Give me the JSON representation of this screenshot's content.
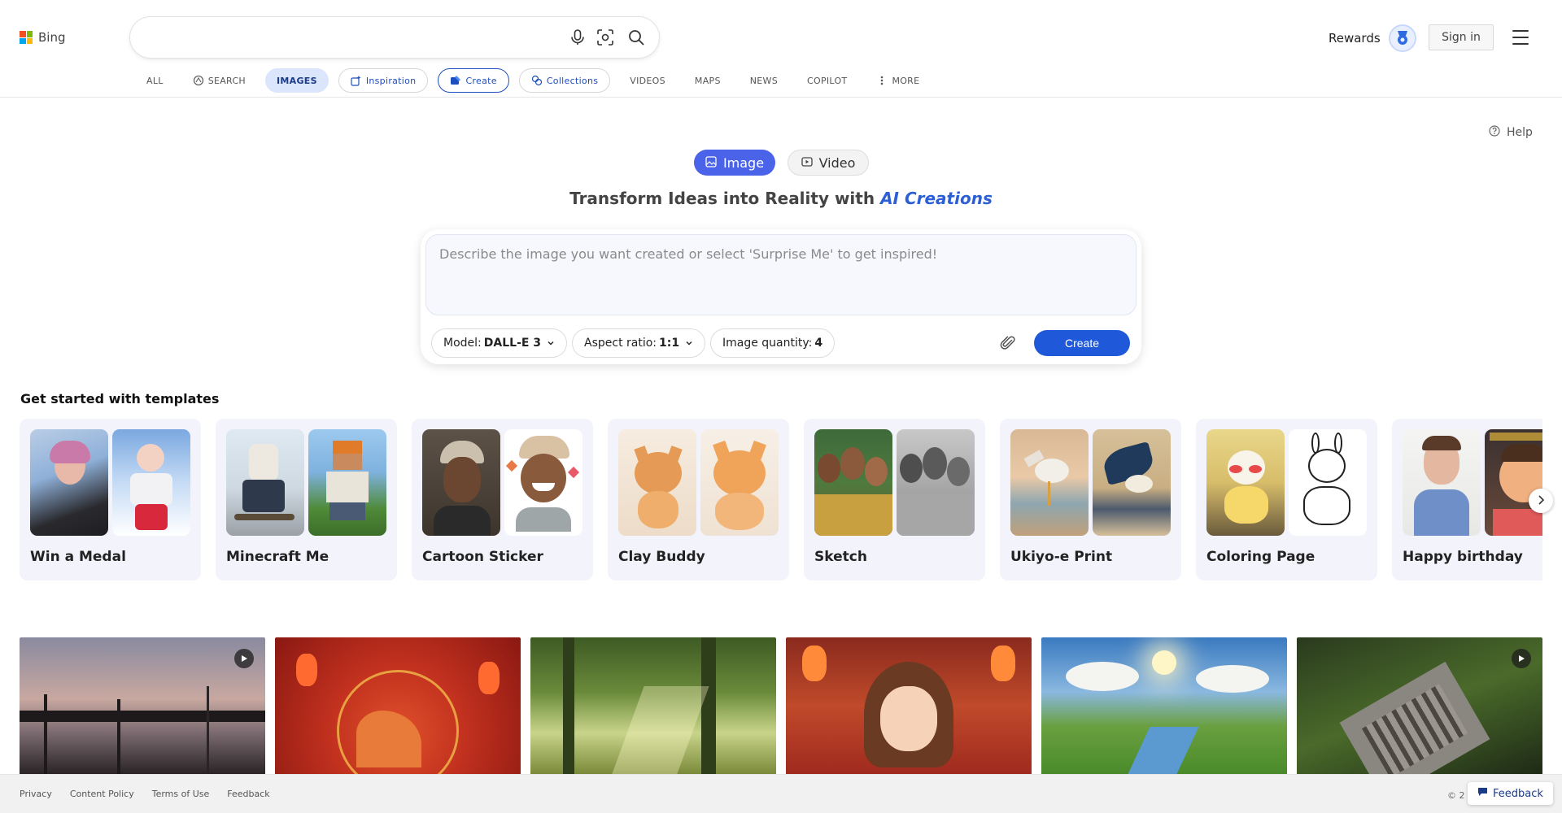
{
  "brand": {
    "name": "Bing"
  },
  "search": {
    "placeholder": "",
    "value": ""
  },
  "header": {
    "rewards_label": "Rewards",
    "signin_label": "Sign in"
  },
  "tabs": [
    {
      "label": "ALL"
    },
    {
      "label": "SEARCH"
    },
    {
      "label": "IMAGES"
    },
    {
      "label": "Inspiration"
    },
    {
      "label": "Create"
    },
    {
      "label": "Collections"
    },
    {
      "label": "VIDEOS"
    },
    {
      "label": "MAPS"
    },
    {
      "label": "NEWS"
    },
    {
      "label": "COPILOT"
    },
    {
      "label": "MORE"
    }
  ],
  "help_label": "Help",
  "mode": {
    "image_label": "Image",
    "video_label": "Video"
  },
  "headline": {
    "prefix": "Transform Ideas into Reality with ",
    "accent": "AI Creations"
  },
  "prompt": {
    "placeholder": "Describe the image you want created or select 'Surprise Me' to get inspired!",
    "model_label": "Model:",
    "model_value": "DALL-E 3",
    "aspect_label": "Aspect ratio:",
    "aspect_value": "1:1",
    "quantity_label": "Image quantity:",
    "quantity_value": "4",
    "create_label": "Create"
  },
  "templates": {
    "heading": "Get started with templates",
    "items": [
      {
        "label": "Win a Medal"
      },
      {
        "label": "Minecraft Me"
      },
      {
        "label": "Cartoon Sticker"
      },
      {
        "label": "Clay Buddy"
      },
      {
        "label": "Sketch"
      },
      {
        "label": "Ukiyo-e Print"
      },
      {
        "label": "Coloring Page"
      },
      {
        "label": "Happy birthday"
      }
    ]
  },
  "footer": {
    "links": [
      "Privacy",
      "Content Policy",
      "Terms of Use",
      "Feedback"
    ],
    "copyright": "© 2",
    "feedback_label": "Feedback"
  },
  "colors": {
    "accent": "#1f59d9",
    "mode_active": "#4b63e8",
    "logo": [
      "#f25022",
      "#7fba00",
      "#00a4ef",
      "#ffb900"
    ]
  },
  "icons": {
    "mic": "microphone-icon",
    "visual_search": "camera-scan-icon",
    "search": "search-icon",
    "menu": "hamburger-menu-icon",
    "attach": "paperclip-icon"
  }
}
